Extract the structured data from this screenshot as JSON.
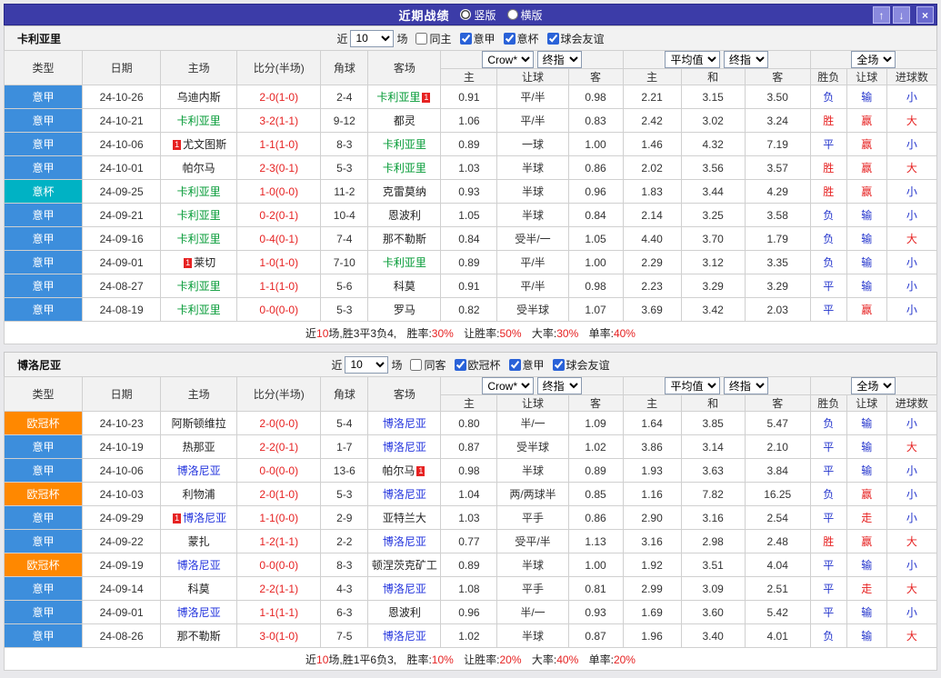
{
  "titlebar": {
    "title": "近期战绩",
    "view_options": [
      {
        "label": "竖版",
        "selected": true
      },
      {
        "label": "横版",
        "selected": false
      }
    ],
    "up_glyph": "↑",
    "down_glyph": "↓",
    "close_glyph": "×"
  },
  "colors": {
    "titlebar_bg": "#3c3ca8",
    "type": {
      "意甲": "#3d8edc",
      "意杯": "#00b2c4",
      "欧冠杯": "#ff8800"
    },
    "team_default": "#222222",
    "score": "#e62222",
    "result": {
      "胜": "#e62222",
      "负": "#2233cc",
      "平": "#2233cc",
      "赢": "#e62222",
      "输": "#2233cc",
      "走": "#e62222",
      "大": "#e62222",
      "小": "#2233cc"
    }
  },
  "table_header": {
    "cols": [
      "类型",
      "日期",
      "主场",
      "比分(半场)",
      "角球",
      "客场"
    ],
    "odds_source": "Crow*",
    "odds_stage": "终指",
    "avg_source": "平均值",
    "avg_stage": "终指",
    "scope": "全场",
    "sub": [
      "主",
      "让球",
      "客",
      "主",
      "和",
      "客",
      "胜负",
      "让球",
      "进球数"
    ]
  },
  "sections": [
    {
      "team": "卡利亚里",
      "team_color": "#009933",
      "filter": {
        "prefix": "近",
        "count": "10",
        "suffix": "场",
        "options": [
          {
            "label": "同主",
            "checked": false
          },
          {
            "label": "意甲",
            "checked": true
          },
          {
            "label": "意杯",
            "checked": true
          },
          {
            "label": "球会友谊",
            "checked": true
          }
        ]
      },
      "rows": [
        {
          "type": "意甲",
          "date": "24-10-26",
          "home": {
            "name": "乌迪内斯"
          },
          "score": "2-0(1-0)",
          "corner": "2-4",
          "away": {
            "name": "卡利亚里",
            "self": true,
            "badge": "1",
            "badge_pos": "after"
          },
          "o1": "0.91",
          "line": "平/半",
          "o2": "0.98",
          "a1": "2.21",
          "a2": "3.15",
          "a3": "3.50",
          "r": "负",
          "hr": "输",
          "gr": "小"
        },
        {
          "type": "意甲",
          "date": "24-10-21",
          "home": {
            "name": "卡利亚里",
            "self": true
          },
          "score": "3-2(1-1)",
          "corner": "9-12",
          "away": {
            "name": "都灵"
          },
          "o1": "1.06",
          "line": "平/半",
          "o2": "0.83",
          "a1": "2.42",
          "a2": "3.02",
          "a3": "3.24",
          "r": "胜",
          "hr": "赢",
          "gr": "大"
        },
        {
          "type": "意甲",
          "date": "24-10-06",
          "home": {
            "name": "尤文图斯",
            "badge": "1",
            "badge_pos": "before"
          },
          "score": "1-1(1-0)",
          "corner": "8-3",
          "away": {
            "name": "卡利亚里",
            "self": true
          },
          "o1": "0.89",
          "line": "一球",
          "o2": "1.00",
          "a1": "1.46",
          "a2": "4.32",
          "a3": "7.19",
          "r": "平",
          "hr": "赢",
          "gr": "小"
        },
        {
          "type": "意甲",
          "date": "24-10-01",
          "home": {
            "name": "帕尔马"
          },
          "score": "2-3(0-1)",
          "corner": "5-3",
          "away": {
            "name": "卡利亚里",
            "self": true
          },
          "o1": "1.03",
          "line": "半球",
          "o2": "0.86",
          "a1": "2.02",
          "a2": "3.56",
          "a3": "3.57",
          "r": "胜",
          "hr": "赢",
          "gr": "大"
        },
        {
          "type": "意杯",
          "date": "24-09-25",
          "home": {
            "name": "卡利亚里",
            "self": true
          },
          "score": "1-0(0-0)",
          "corner": "11-2",
          "away": {
            "name": "克雷莫纳"
          },
          "o1": "0.93",
          "line": "半球",
          "o2": "0.96",
          "a1": "1.83",
          "a2": "3.44",
          "a3": "4.29",
          "r": "胜",
          "hr": "赢",
          "gr": "小"
        },
        {
          "type": "意甲",
          "date": "24-09-21",
          "home": {
            "name": "卡利亚里",
            "self": true
          },
          "score": "0-2(0-1)",
          "corner": "10-4",
          "away": {
            "name": "恩波利"
          },
          "o1": "1.05",
          "line": "半球",
          "o2": "0.84",
          "a1": "2.14",
          "a2": "3.25",
          "a3": "3.58",
          "r": "负",
          "hr": "输",
          "gr": "小"
        },
        {
          "type": "意甲",
          "date": "24-09-16",
          "home": {
            "name": "卡利亚里",
            "self": true
          },
          "score": "0-4(0-1)",
          "corner": "7-4",
          "away": {
            "name": "那不勒斯"
          },
          "o1": "0.84",
          "line": "受半/一",
          "o2": "1.05",
          "a1": "4.40",
          "a2": "3.70",
          "a3": "1.79",
          "r": "负",
          "hr": "输",
          "gr": "大"
        },
        {
          "type": "意甲",
          "date": "24-09-01",
          "home": {
            "name": "莱切",
            "badge": "1",
            "badge_pos": "before"
          },
          "score": "1-0(1-0)",
          "corner": "7-10",
          "away": {
            "name": "卡利亚里",
            "self": true
          },
          "o1": "0.89",
          "line": "平/半",
          "o2": "1.00",
          "a1": "2.29",
          "a2": "3.12",
          "a3": "3.35",
          "r": "负",
          "hr": "输",
          "gr": "小"
        },
        {
          "type": "意甲",
          "date": "24-08-27",
          "home": {
            "name": "卡利亚里",
            "self": true
          },
          "score": "1-1(1-0)",
          "corner": "5-6",
          "away": {
            "name": "科莫"
          },
          "o1": "0.91",
          "line": "平/半",
          "o2": "0.98",
          "a1": "2.23",
          "a2": "3.29",
          "a3": "3.29",
          "r": "平",
          "hr": "输",
          "gr": "小"
        },
        {
          "type": "意甲",
          "date": "24-08-19",
          "home": {
            "name": "卡利亚里",
            "self": true
          },
          "score": "0-0(0-0)",
          "corner": "5-3",
          "away": {
            "name": "罗马"
          },
          "o1": "0.82",
          "line": "受半球",
          "o2": "1.07",
          "a1": "3.69",
          "a2": "3.42",
          "a3": "2.03",
          "r": "平",
          "hr": "赢",
          "gr": "小"
        }
      ],
      "footer": {
        "prefix": "近",
        "games": "10",
        "summary": "场,胜3平3负4,",
        "win_label": "胜率:",
        "win_rate": "30%",
        "handicap_label": "让胜率:",
        "handicap_rate": "50%",
        "over_label": "大率:",
        "over_rate": "30%",
        "odd_label": "单率:",
        "odd_rate": "40%"
      }
    },
    {
      "team": "博洛尼亚",
      "team_color": "#2233dd",
      "filter": {
        "prefix": "近",
        "count": "10",
        "suffix": "场",
        "options": [
          {
            "label": "同客",
            "checked": false
          },
          {
            "label": "欧冠杯",
            "checked": true
          },
          {
            "label": "意甲",
            "checked": true
          },
          {
            "label": "球会友谊",
            "checked": true
          }
        ]
      },
      "rows": [
        {
          "type": "欧冠杯",
          "date": "24-10-23",
          "home": {
            "name": "阿斯顿维拉"
          },
          "score": "2-0(0-0)",
          "corner": "5-4",
          "away": {
            "name": "博洛尼亚",
            "self": true
          },
          "o1": "0.80",
          "line": "半/一",
          "o2": "1.09",
          "a1": "1.64",
          "a2": "3.85",
          "a3": "5.47",
          "r": "负",
          "hr": "输",
          "gr": "小"
        },
        {
          "type": "意甲",
          "date": "24-10-19",
          "home": {
            "name": "热那亚"
          },
          "score": "2-2(0-1)",
          "corner": "1-7",
          "away": {
            "name": "博洛尼亚",
            "self": true
          },
          "o1": "0.87",
          "line": "受半球",
          "o2": "1.02",
          "a1": "3.86",
          "a2": "3.14",
          "a3": "2.10",
          "r": "平",
          "hr": "输",
          "gr": "大"
        },
        {
          "type": "意甲",
          "date": "24-10-06",
          "home": {
            "name": "博洛尼亚",
            "self": true
          },
          "score": "0-0(0-0)",
          "corner": "13-6",
          "away": {
            "name": "帕尔马",
            "badge": "1",
            "badge_pos": "after"
          },
          "o1": "0.98",
          "line": "半球",
          "o2": "0.89",
          "a1": "1.93",
          "a2": "3.63",
          "a3": "3.84",
          "r": "平",
          "hr": "输",
          "gr": "小"
        },
        {
          "type": "欧冠杯",
          "date": "24-10-03",
          "home": {
            "name": "利物浦"
          },
          "score": "2-0(1-0)",
          "corner": "5-3",
          "away": {
            "name": "博洛尼亚",
            "self": true
          },
          "o1": "1.04",
          "line": "两/两球半",
          "o2": "0.85",
          "a1": "1.16",
          "a2": "7.82",
          "a3": "16.25",
          "r": "负",
          "hr": "赢",
          "gr": "小"
        },
        {
          "type": "意甲",
          "date": "24-09-29",
          "home": {
            "name": "博洛尼亚",
            "self": true,
            "badge": "1",
            "badge_pos": "before"
          },
          "score": "1-1(0-0)",
          "corner": "2-9",
          "away": {
            "name": "亚特兰大"
          },
          "o1": "1.03",
          "line": "平手",
          "o2": "0.86",
          "a1": "2.90",
          "a2": "3.16",
          "a3": "2.54",
          "r": "平",
          "hr": "走",
          "gr": "小"
        },
        {
          "type": "意甲",
          "date": "24-09-22",
          "home": {
            "name": "蒙扎"
          },
          "score": "1-2(1-1)",
          "corner": "2-2",
          "away": {
            "name": "博洛尼亚",
            "self": true
          },
          "o1": "0.77",
          "line": "受平/半",
          "o2": "1.13",
          "a1": "3.16",
          "a2": "2.98",
          "a3": "2.48",
          "r": "胜",
          "hr": "赢",
          "gr": "大"
        },
        {
          "type": "欧冠杯",
          "date": "24-09-19",
          "home": {
            "name": "博洛尼亚",
            "self": true
          },
          "score": "0-0(0-0)",
          "corner": "8-3",
          "away": {
            "name": "顿涅茨克矿工"
          },
          "o1": "0.89",
          "line": "半球",
          "o2": "1.00",
          "a1": "1.92",
          "a2": "3.51",
          "a3": "4.04",
          "r": "平",
          "hr": "输",
          "gr": "小"
        },
        {
          "type": "意甲",
          "date": "24-09-14",
          "home": {
            "name": "科莫"
          },
          "score": "2-2(1-1)",
          "corner": "4-3",
          "away": {
            "name": "博洛尼亚",
            "self": true
          },
          "o1": "1.08",
          "line": "平手",
          "o2": "0.81",
          "a1": "2.99",
          "a2": "3.09",
          "a3": "2.51",
          "r": "平",
          "hr": "走",
          "gr": "大"
        },
        {
          "type": "意甲",
          "date": "24-09-01",
          "home": {
            "name": "博洛尼亚",
            "self": true
          },
          "score": "1-1(1-1)",
          "corner": "6-3",
          "away": {
            "name": "恩波利"
          },
          "o1": "0.96",
          "line": "半/一",
          "o2": "0.93",
          "a1": "1.69",
          "a2": "3.60",
          "a3": "5.42",
          "r": "平",
          "hr": "输",
          "gr": "小"
        },
        {
          "type": "意甲",
          "date": "24-08-26",
          "home": {
            "name": "那不勒斯"
          },
          "score": "3-0(1-0)",
          "corner": "7-5",
          "away": {
            "name": "博洛尼亚",
            "self": true
          },
          "o1": "1.02",
          "line": "半球",
          "o2": "0.87",
          "a1": "1.96",
          "a2": "3.40",
          "a3": "4.01",
          "r": "负",
          "hr": "输",
          "gr": "大"
        }
      ],
      "footer": {
        "prefix": "近",
        "games": "10",
        "summary": "场,胜1平6负3,",
        "win_label": "胜率:",
        "win_rate": "10%",
        "handicap_label": "让胜率:",
        "handicap_rate": "20%",
        "over_label": "大率:",
        "over_rate": "40%",
        "odd_label": "单率:",
        "odd_rate": "20%"
      }
    }
  ]
}
